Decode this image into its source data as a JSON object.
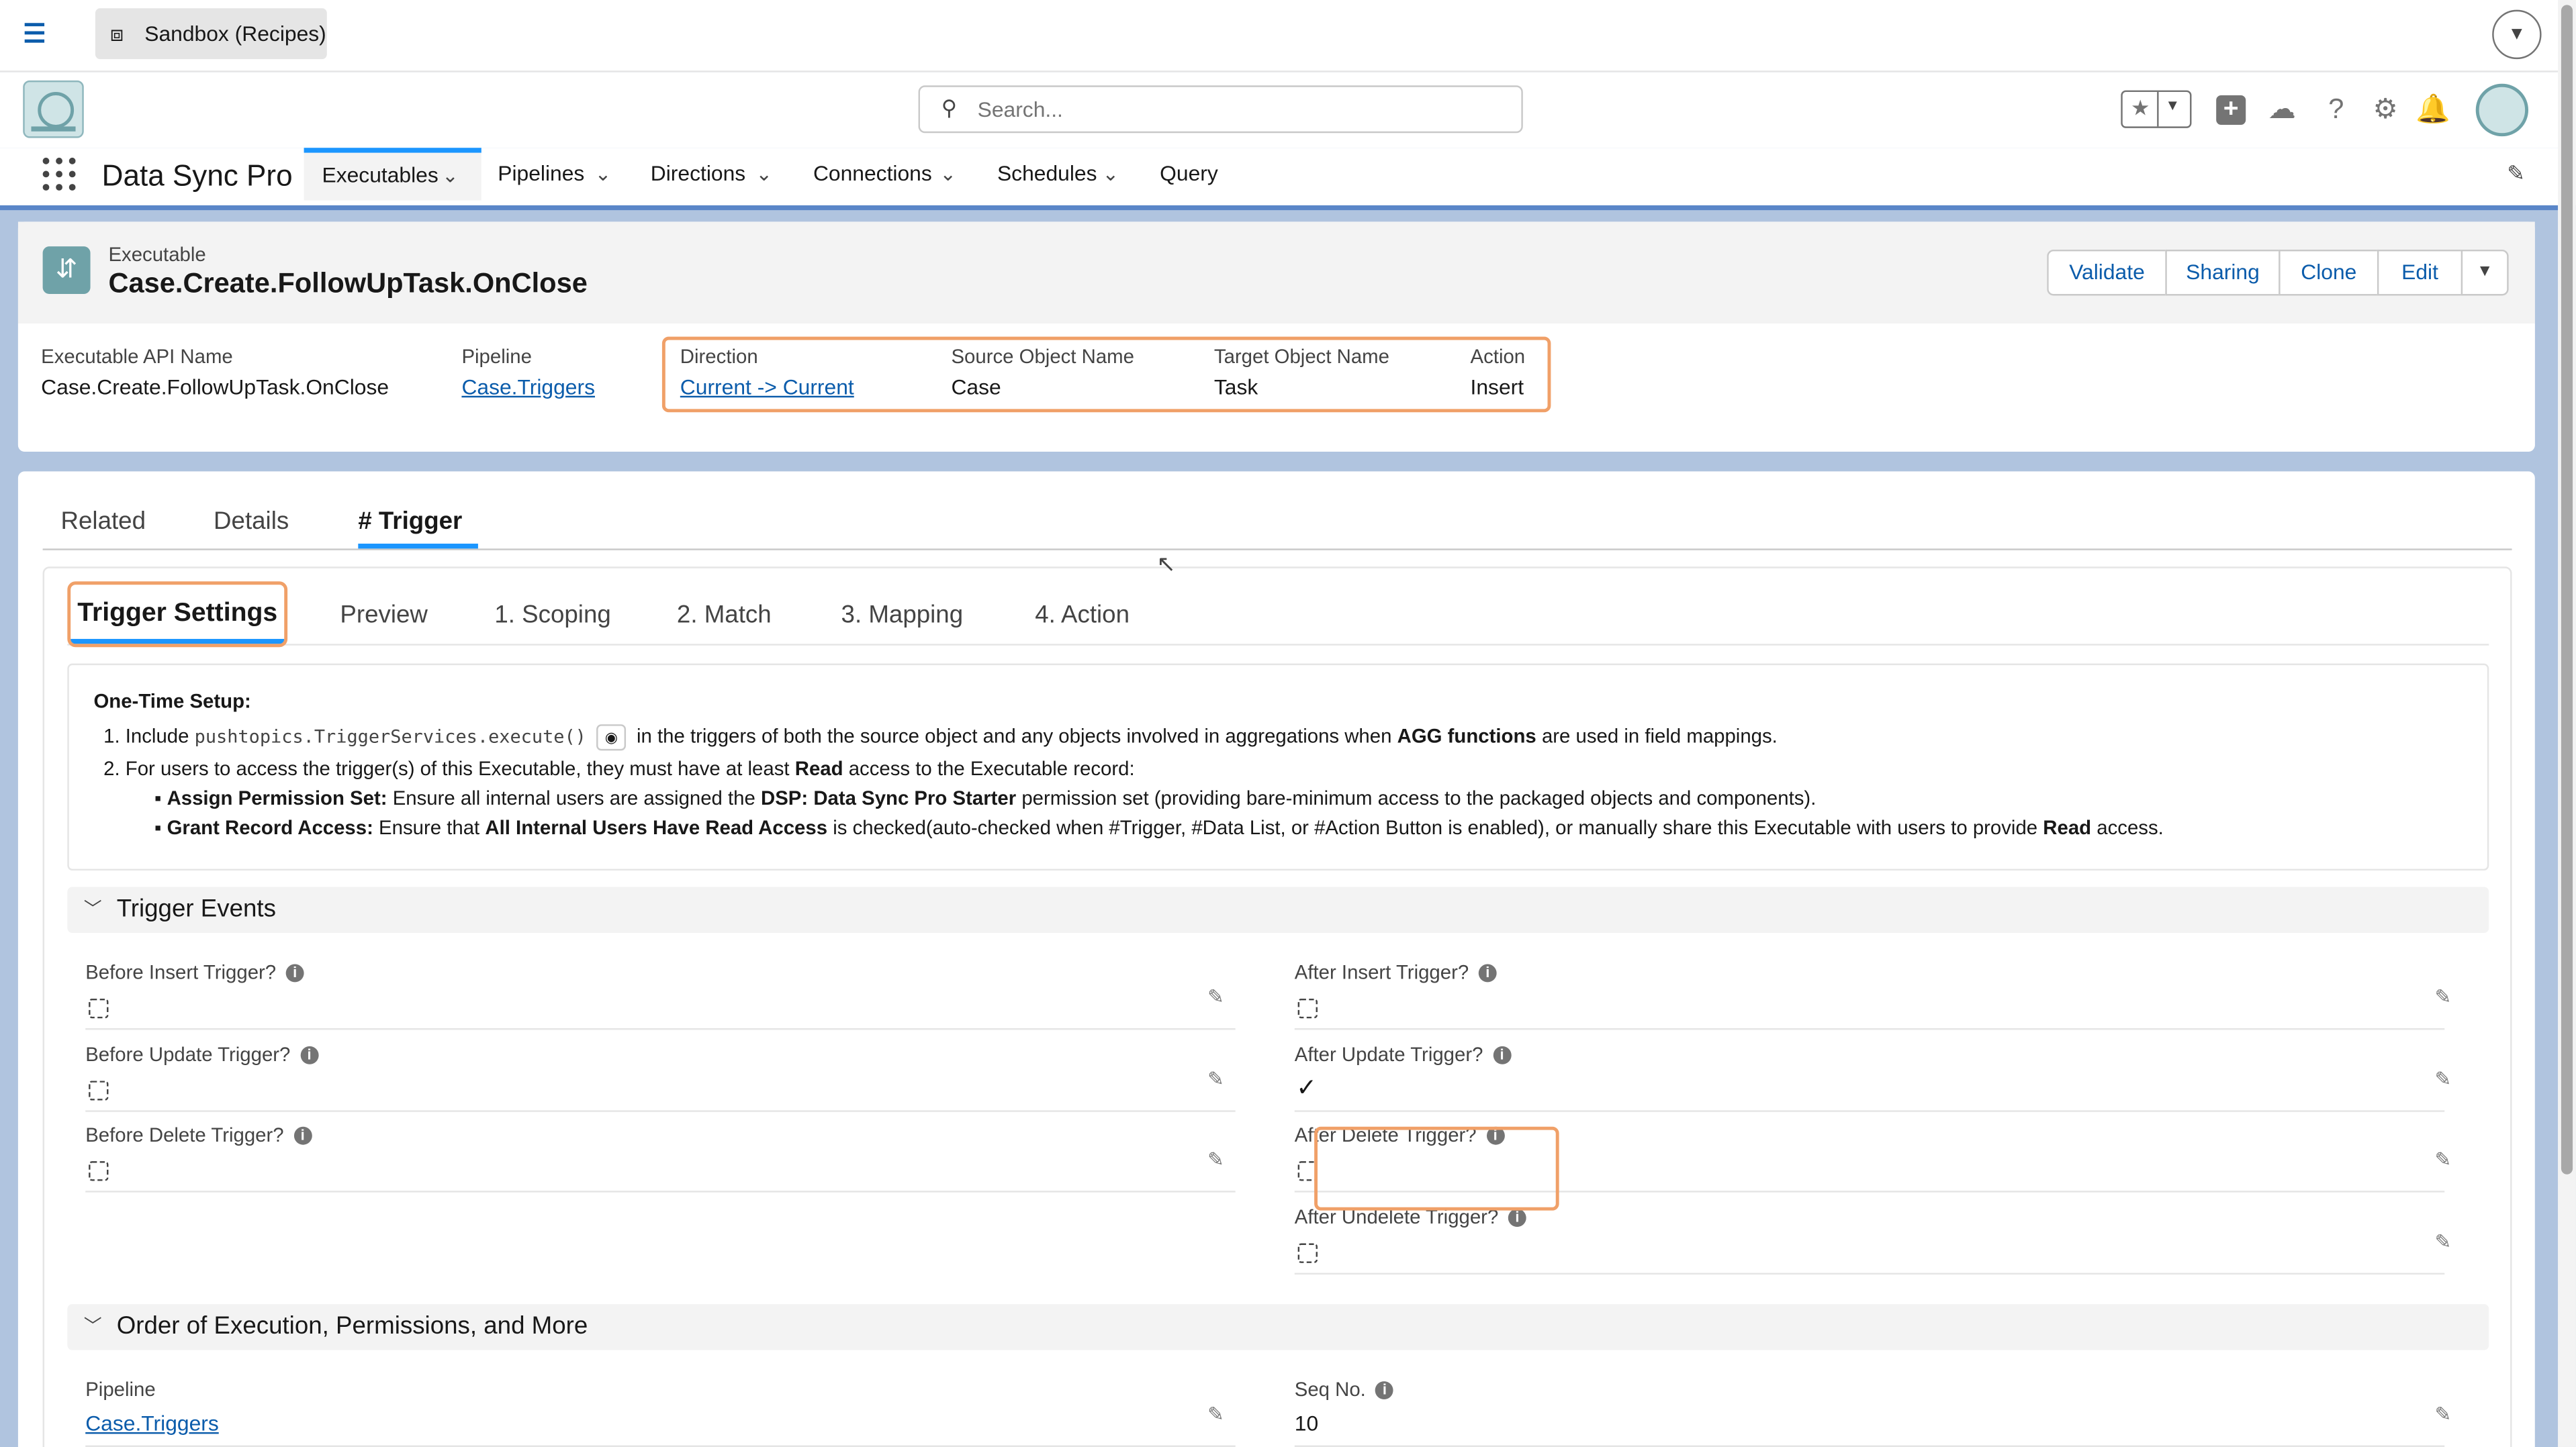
{
  "sandbox": {
    "label": "Sandbox (Recipes)"
  },
  "search": {
    "placeholder": "Search..."
  },
  "app": {
    "name": "Data Sync Pro"
  },
  "nav": {
    "items": [
      {
        "label": "Executables"
      },
      {
        "label": "Pipelines"
      },
      {
        "label": "Directions"
      },
      {
        "label": "Connections"
      },
      {
        "label": "Schedules"
      },
      {
        "label": "Query"
      }
    ]
  },
  "record": {
    "type": "Executable",
    "title": "Case.Create.FollowUpTask.OnClose",
    "buttons": [
      "Validate",
      "Sharing",
      "Clone",
      "Edit"
    ],
    "highlights": [
      {
        "label": "Executable API Name",
        "value": "Case.Create.FollowUpTask.OnClose"
      },
      {
        "label": "Pipeline",
        "value": "Case.Triggers"
      },
      {
        "label": "Direction",
        "value": "Current -> Current"
      },
      {
        "label": "Source Object Name",
        "value": "Case"
      },
      {
        "label": "Target Object Name",
        "value": "Task"
      },
      {
        "label": "Action",
        "value": "Insert"
      }
    ]
  },
  "tabs": [
    "Related",
    "Details",
    "# Trigger"
  ],
  "subtabs": [
    "Trigger Settings",
    "Preview",
    "1. Scoping",
    "2. Match",
    "3. Mapping",
    "4. Action"
  ],
  "setup": {
    "title": "One-Time Setup:",
    "l1_prefix": "1. Include",
    "l1_code": "pushtopics.TriggerServices.execute()",
    "l1_mid": "in the triggers of both the source object and any objects involved in aggregations when",
    "l1_bold": "AGG functions",
    "l1_suffix": "are used in field mappings.",
    "l2_prefix": "2. For users to access the trigger(s) of this Executable, they must have at least",
    "l2_bold": "Read",
    "l2_suffix": "access to the Executable record:",
    "b1_bold": "Assign Permission Set:",
    "b1_text": "Ensure all internal users are assigned the",
    "b1_bold2": "DSP: Data Sync Pro Starter",
    "b1_suffix": "permission set (providing bare-minimum access to the packaged objects and components).",
    "b2_bold": "Grant Record Access:",
    "b2_text": "Ensure that",
    "b2_bold2": "All Internal Users Have Read Access",
    "b2_mid": "is checked(auto-checked when #Trigger, #Data List, or #Action Button is enabled), or manually share this Executable with users to provide",
    "b2_bold3": "Read",
    "b2_suffix": "access."
  },
  "trigger_events": {
    "title": "Trigger Events",
    "fields": [
      {
        "label": "Before Insert Trigger?",
        "checked": false
      },
      {
        "label": "After Insert Trigger?",
        "checked": false
      },
      {
        "label": "Before Update Trigger?",
        "checked": false
      },
      {
        "label": "After Update Trigger?",
        "checked": true
      },
      {
        "label": "Before Delete Trigger?",
        "checked": false
      },
      {
        "label": "After Delete Trigger?",
        "checked": false
      },
      {
        "label": "After Undelete Trigger?",
        "checked": false
      }
    ]
  },
  "order_section": {
    "title": "Order of Execution, Permissions, and More",
    "pipeline_label": "Pipeline",
    "pipeline_value": "Case.Triggers",
    "seq_label": "Seq No.",
    "seq_value": "10"
  },
  "colors": {
    "accent": "#1b96ff",
    "link": "#0b5cab",
    "highlight": "#f0a068"
  }
}
